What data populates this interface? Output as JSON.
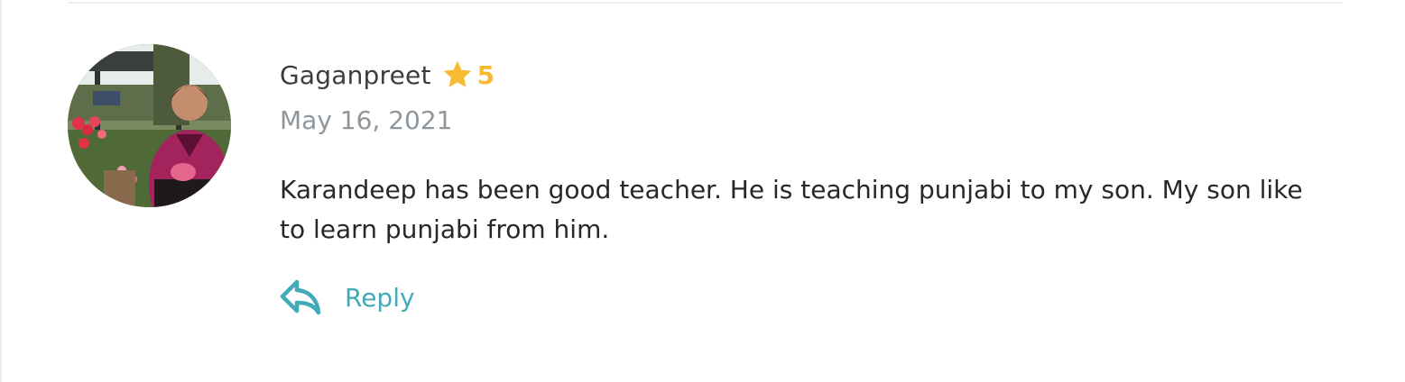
{
  "review": {
    "author": "Gaganpreet",
    "rating": "5",
    "date": "May 16, 2021",
    "text": "Karandeep has been good teacher. He is teaching punjabi to my son. My son like to learn punjabi from him.",
    "reply_label": "Reply"
  },
  "colors": {
    "star": "#f6bb32",
    "reply": "#42aab8",
    "name": "#3b3d40",
    "date": "#8f969c"
  },
  "icons": {
    "star": "star-icon",
    "reply": "reply-arrow-icon",
    "avatar": "user-photo"
  }
}
